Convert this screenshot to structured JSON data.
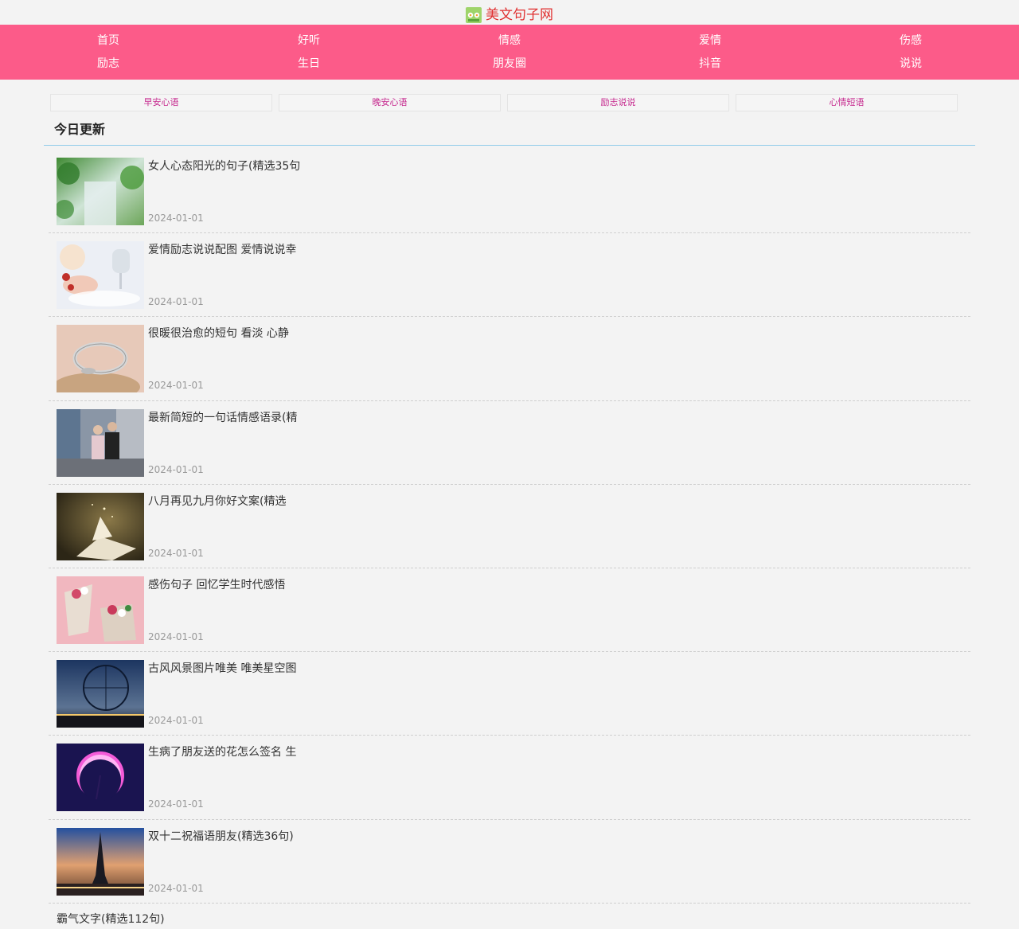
{
  "site": {
    "name": "美文句子网"
  },
  "nav": [
    {
      "label": "首页"
    },
    {
      "label": "好听"
    },
    {
      "label": "情感"
    },
    {
      "label": "爱情"
    },
    {
      "label": "伤感"
    },
    {
      "label": "励志"
    },
    {
      "label": "生日"
    },
    {
      "label": "朋友圈"
    },
    {
      "label": "抖音"
    },
    {
      "label": "说说"
    }
  ],
  "quick_links": [
    {
      "label": "早安心语"
    },
    {
      "label": "晚安心语"
    },
    {
      "label": "励志说说"
    },
    {
      "label": "心情短语"
    }
  ],
  "section": {
    "title": "今日更新"
  },
  "articles": [
    {
      "title": "女人心态阳光的句子(精选35句",
      "date": "2024-01-01"
    },
    {
      "title": "爱情励志说说配图 爱情说说幸",
      "date": "2024-01-01"
    },
    {
      "title": "很暖很治愈的短句 看淡 心静",
      "date": "2024-01-01"
    },
    {
      "title": "最新简短的一句话情感语录(精",
      "date": "2024-01-01"
    },
    {
      "title": "八月再见九月你好文案(精选",
      "date": "2024-01-01"
    },
    {
      "title": "感伤句子 回忆学生时代感悟",
      "date": "2024-01-01"
    },
    {
      "title": "古风风景图片唯美 唯美星空图",
      "date": "2024-01-01"
    },
    {
      "title": "生病了朋友送的花怎么签名 生",
      "date": "2024-01-01"
    },
    {
      "title": "双十二祝福语朋友(精选36句)",
      "date": "2024-01-01"
    }
  ],
  "partial_article": {
    "title": "霸气文字(精选112句)"
  },
  "colors": {
    "nav_bg": "#fc5b89",
    "quick_link_text": "#c62a8f",
    "logo_text": "#e02f2f",
    "section_rule": "#8fcbe9"
  }
}
